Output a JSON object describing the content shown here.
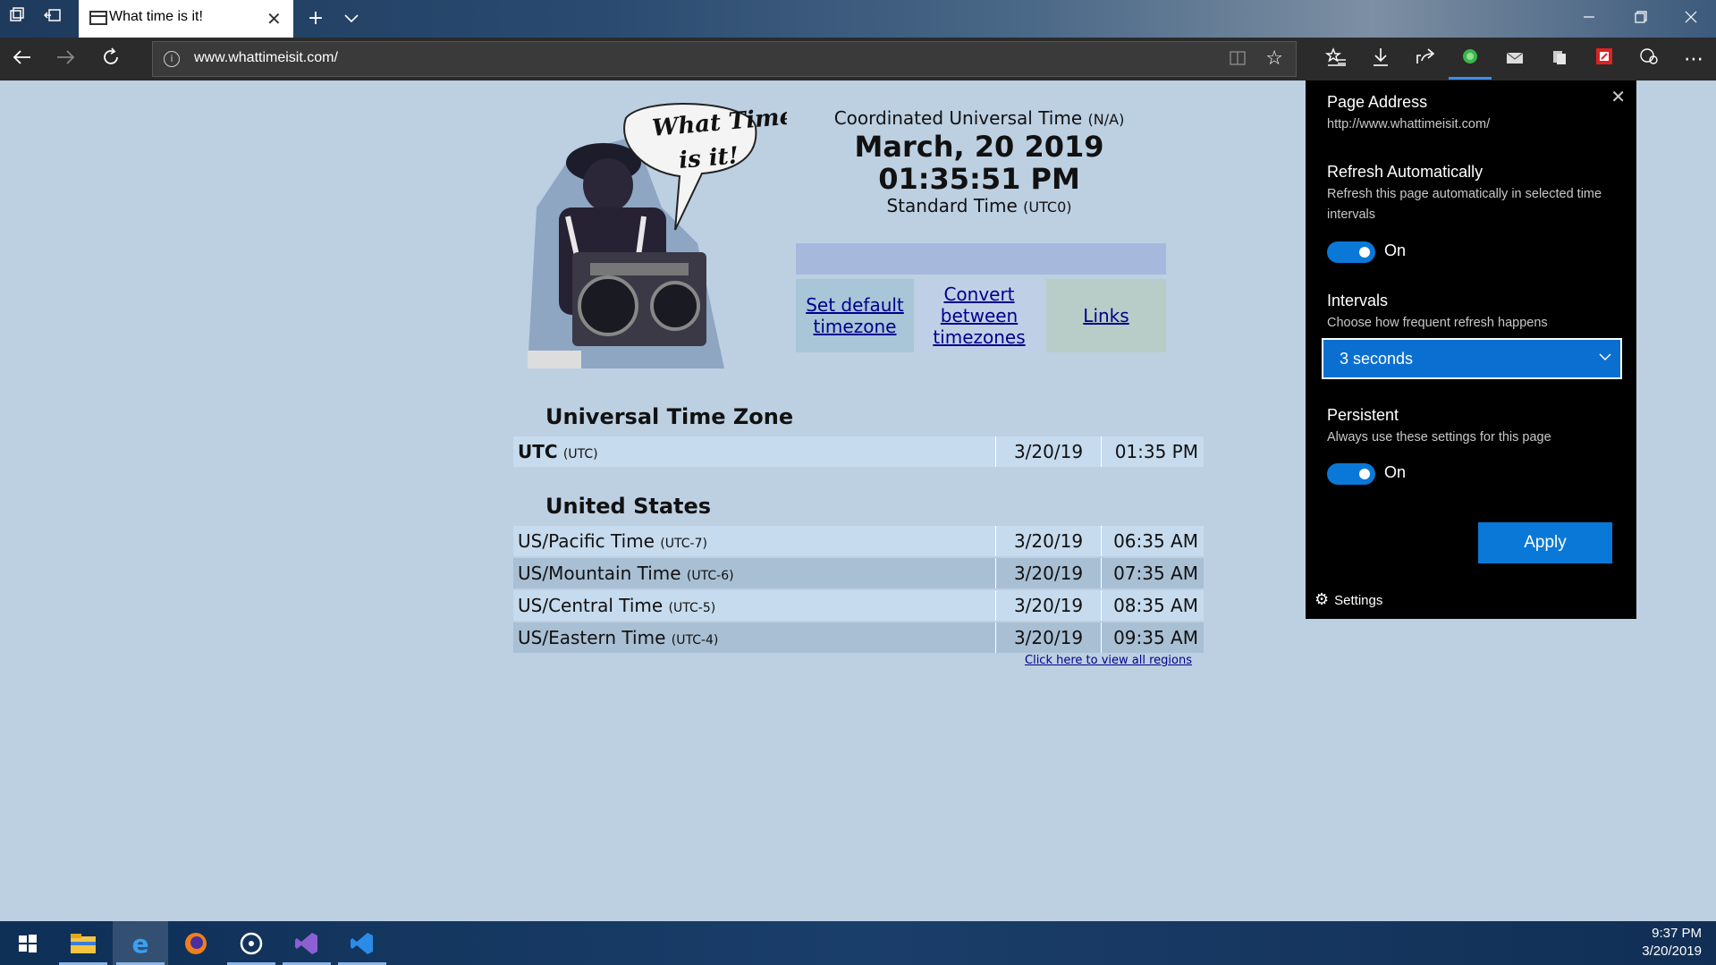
{
  "browser": {
    "tab_title": "What time is it!",
    "url": "www.whattimeisit.com/"
  },
  "clock": {
    "title": "Coordinated Universal Time",
    "title_suffix": "(N/A)",
    "date": "March, 20 2019",
    "time": "01:35:51 PM",
    "standard": "Standard Time",
    "standard_suffix": "(UTC0)"
  },
  "mascot": {
    "speech_line1": "What Time",
    "speech_line2": "is it!"
  },
  "links": {
    "set_default_line1": "Set default",
    "set_default_line2": "timezone",
    "convert_line1": "Convert",
    "convert_line2": "between",
    "convert_line3": "timezones",
    "links": "Links"
  },
  "sections": {
    "universal": "Universal Time Zone",
    "us": "United States"
  },
  "universal_rows": [
    {
      "name": "UTC",
      "offset": "(UTC)",
      "date": "3/20/19",
      "time": "01:35 PM"
    }
  ],
  "us_rows": [
    {
      "name": "US/Pacific Time",
      "offset": "(UTC-7)",
      "date": "3/20/19",
      "time": "06:35 AM"
    },
    {
      "name": "US/Mountain Time",
      "offset": "(UTC-6)",
      "date": "3/20/19",
      "time": "07:35 AM"
    },
    {
      "name": "US/Central Time",
      "offset": "(UTC-5)",
      "date": "3/20/19",
      "time": "08:35 AM"
    },
    {
      "name": "US/Eastern Time",
      "offset": "(UTC-4)",
      "date": "3/20/19",
      "time": "09:35 AM"
    }
  ],
  "view_all": "Click here to view all regions",
  "flyout": {
    "page_address_label": "Page Address",
    "page_address_value": "http://www.whattimeisit.com/",
    "refresh_label": "Refresh Automatically",
    "refresh_desc": "Refresh this page automatically in selected time intervals",
    "refresh_state": "On",
    "intervals_label": "Intervals",
    "intervals_desc": "Choose how frequent refresh happens",
    "interval_value": "3 seconds",
    "persistent_label": "Persistent",
    "persistent_desc": "Always use these settings for this page",
    "persistent_state": "On",
    "apply_label": "Apply",
    "settings_label": "Settings"
  },
  "tray": {
    "time": "9:37 PM",
    "date": "3/20/2019"
  },
  "colors": {
    "accent": "#0a78d7",
    "page_bg": "#bdd0e2",
    "link": "#00008b"
  }
}
